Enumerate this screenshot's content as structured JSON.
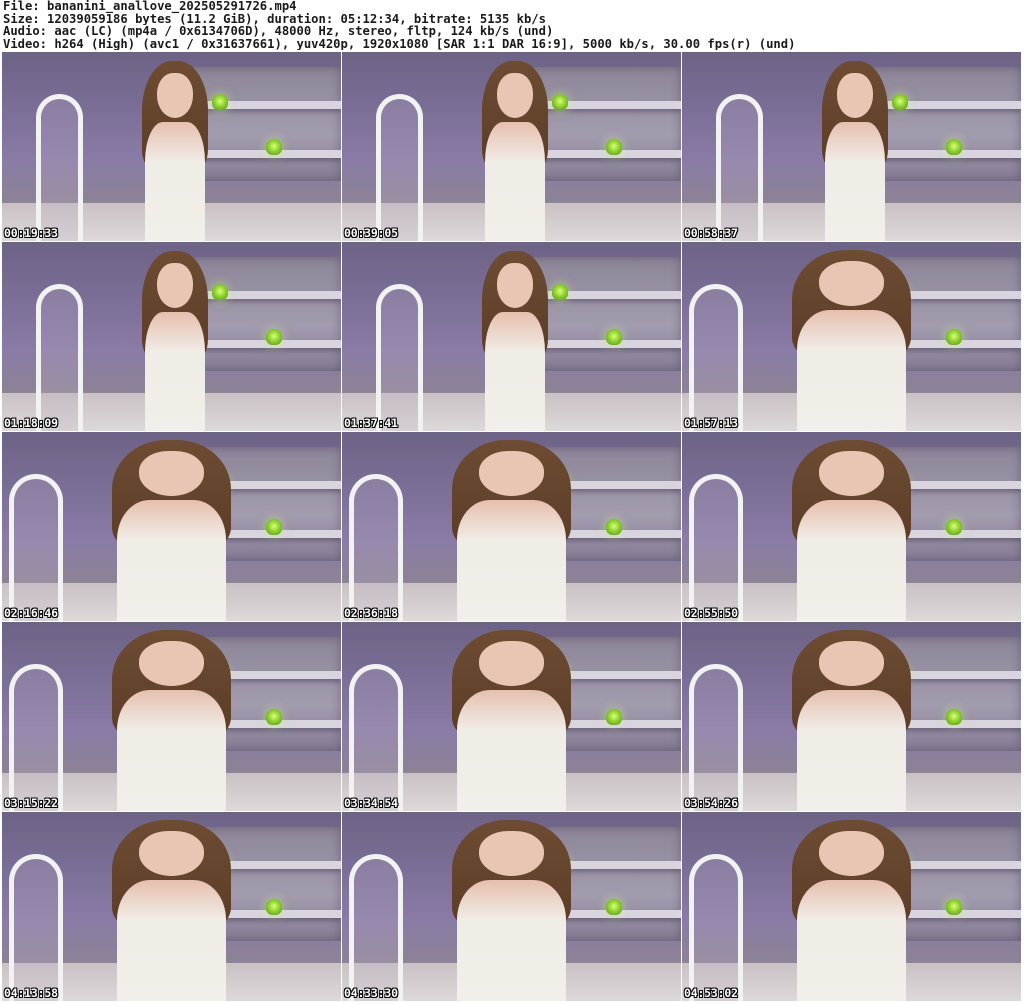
{
  "header": {
    "file": "File: bananini_anallove_202505291726.mp4",
    "size": "Size: 12039059186 bytes (11.2 GiB), duration: 05:12:34, bitrate: 5135 kb/s",
    "audio": "Audio: aac (LC) (mp4a / 0x6134706D), 48000 Hz, stereo, fltp, 124 kb/s (und)",
    "video": "Video: h264 (High) (avc1 / 0x31637661), yuv420p, 1920x1080 [SAR 1:1 DAR 16:9], 5000 kb/s, 30.00 fps(r) (und)"
  },
  "thumbnails": [
    {
      "timestamp": "00:19:33",
      "view": "wide"
    },
    {
      "timestamp": "00:39:05",
      "view": "wide"
    },
    {
      "timestamp": "00:58:37",
      "view": "wide"
    },
    {
      "timestamp": "01:18:09",
      "view": "wide"
    },
    {
      "timestamp": "01:37:41",
      "view": "wide"
    },
    {
      "timestamp": "01:57:13",
      "view": "close"
    },
    {
      "timestamp": "02:16:46",
      "view": "close"
    },
    {
      "timestamp": "02:36:18",
      "view": "close"
    },
    {
      "timestamp": "02:55:50",
      "view": "close"
    },
    {
      "timestamp": "03:15:22",
      "view": "close"
    },
    {
      "timestamp": "03:34:54",
      "view": "close"
    },
    {
      "timestamp": "03:54:26",
      "view": "close"
    },
    {
      "timestamp": "04:13:58",
      "view": "close"
    },
    {
      "timestamp": "04:33:30",
      "view": "close"
    },
    {
      "timestamp": "04:53:02",
      "view": "close"
    }
  ]
}
